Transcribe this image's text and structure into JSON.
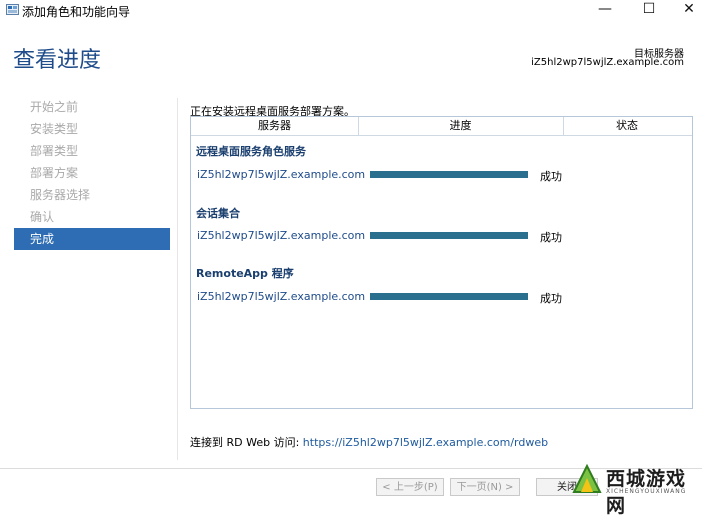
{
  "window": {
    "title": "添加角色和功能向导",
    "minimize_glyph": "—",
    "maximize_glyph": "☐",
    "close_glyph": "✕"
  },
  "header": {
    "page_title": "查看进度",
    "destination_label": "目标服务器",
    "destination_server": "iZ5hl2wp7l5wjlZ.example.com"
  },
  "nav": {
    "items": [
      {
        "label": "开始之前",
        "active": false
      },
      {
        "label": "安装类型",
        "active": false
      },
      {
        "label": "部署类型",
        "active": false
      },
      {
        "label": "部署方案",
        "active": false
      },
      {
        "label": "服务器选择",
        "active": false
      },
      {
        "label": "确认",
        "active": false
      },
      {
        "label": "完成",
        "active": true
      }
    ]
  },
  "main": {
    "status_text": "正在安装远程桌面服务部署方案。",
    "columns": [
      "服务器",
      "进度",
      "状态"
    ],
    "groups": [
      {
        "title": "远程桌面服务角色服务",
        "server": "iZ5hl2wp7l5wjlZ.example.com",
        "progress": 1.0,
        "status": "成功"
      },
      {
        "title": "会话集合",
        "server": "iZ5hl2wp7l5wjlZ.example.com",
        "progress": 1.0,
        "status": "成功"
      },
      {
        "title": "RemoteApp 程序",
        "server": "iZ5hl2wp7l5wjlZ.example.com",
        "progress": 1.0,
        "status": "成功"
      }
    ],
    "rdweb_prefix": "连接到 RD Web 访问: ",
    "rdweb_url": "https://iZ5hl2wp7l5wjlZ.example.com/rdweb"
  },
  "footer": {
    "prev_label": "< 上一步(P)",
    "next_label": "下一页(N) >",
    "close_label": "关闭"
  },
  "watermark": {
    "text": "西城游戏网",
    "subtext": "XICHENGYOUXIWANG"
  },
  "colors": {
    "accent": "#2e6db4",
    "title": "#1e4b8a",
    "progress_bar": "#2b6f8e"
  }
}
